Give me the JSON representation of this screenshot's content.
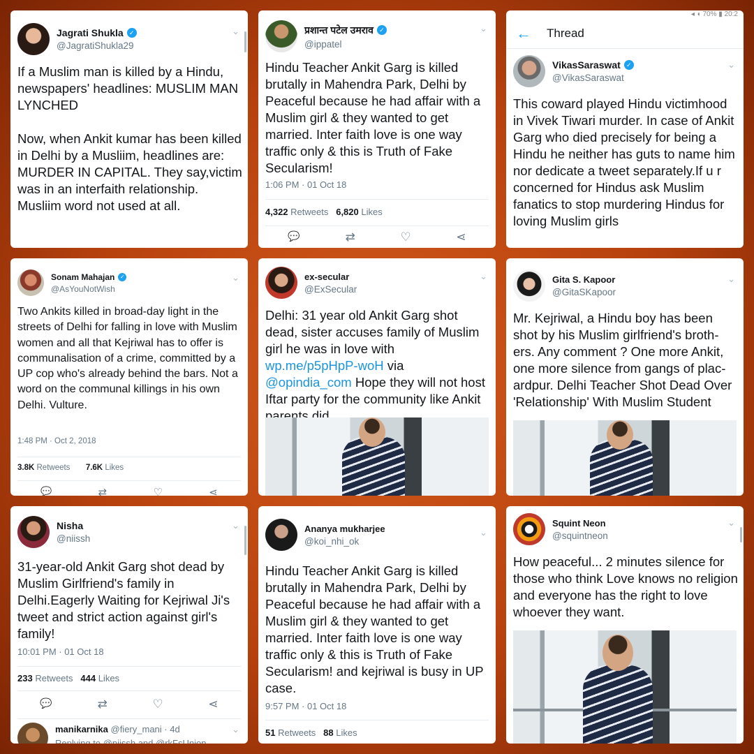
{
  "tweets": [
    {
      "name": "Jagrati Shukla",
      "handle": "@JagratiShukla29",
      "text": "If a Muslim man is killed by a Hindu, newspapers' headlines: MUSLIM MAN LYNCHED\n\nNow, when Ankit kumar has been killed in Delhi by a Musliim, headlines are: MURDER IN CAPITAL. They say,victim was in an interfaith relationship. Musliim word not used at all."
    },
    {
      "name": "प्रशान्त पटेल उमराव",
      "handle": "@ippatel",
      "text": "Hindu Teacher Ankit Garg is killed brutally in Mahendra Park, Delhi by Peaceful because he had affair with a Muslim girl & they wanted to get married. Inter faith love is one way traffic only & this is Truth of Fake Secularism!",
      "time": "1:06 PM · 01 Oct 18",
      "retweets": "4,322",
      "retweets_label": "Retweets",
      "likes": "6,820",
      "likes_label": "Likes"
    },
    {
      "status_bar": "◂ ◖ 70% ▮ 20:2",
      "back_label": "←",
      "thread_title": "Thread",
      "name": "VikasSaraswat",
      "handle": "@VikasSaraswat",
      "text": "This coward played Hindu victimhood in Vivek Tiwari murder. In case of Ankit Garg who died precisely for being a Hindu he neither has guts to name him nor dedicate a tweet separately.If u r concerned for Hindus ask Muslim fanatics to stop murdering Hindus for loving Muslim girls"
    },
    {
      "name": "Sonam Mahajan",
      "handle": "@AsYouNotWish",
      "text": "Two Ankits killed in broad-day light in the streets of Delhi for falling in love with Muslim women and all that Kejriwal has to offer is communalisation of a crime, committed by a UP cop who's already behind the bars. Not a word on the communal killings in his own Delhi. Vulture.",
      "time": "1:48 PM · Oct 2, 2018",
      "retweets": "3.8K",
      "retweets_label": "Retweets",
      "likes": "7.6K",
      "likes_label": "Likes"
    },
    {
      "name": "ex-secular",
      "handle": "@ExSecular",
      "text_a": "Delhi: 31 year old Ankit Garg shot dead, sister accuses family of Muslim girl he was in love with ",
      "link1": "wp.me/p5pHpP-woH",
      "text_b": " via ",
      "link2": "@opindia_com",
      "text_c": " Hope they will not host Iftar party for the community like Ankit parents did"
    },
    {
      "name": "Gita S. Kapoor",
      "handle": "@GitaSKapoor",
      "text": "Mr. Kejriwal, a Hindu boy has been shot by his Muslim girlfriend's broth-ers. Any comment ? One more Ankit, one more silence from gangs of plac-ardpur.  Delhi Teacher Shot Dead Over 'Relationship' With Muslim Student"
    },
    {
      "name": "Nisha",
      "handle": "@niissh",
      "text": "31-year-old Ankit Garg shot dead by Muslim Girlfriend's family in Delhi.Eagerly Waiting for Kejriwal Ji's tweet and strict action against girl's family!",
      "time": "10:01 PM · 01 Oct 18",
      "retweets": "233",
      "retweets_label": "Retweets",
      "likes": "444",
      "likes_label": "Likes",
      "reply_name": "manikarnika",
      "reply_handle": "@fiery_mani · 4d",
      "reply_to": "Replying to @niissh and @rkFsUnion"
    },
    {
      "name": "Ananya mukharjee",
      "handle": "@koi_nhi_ok",
      "text": "Hindu Teacher Ankit Garg is killed brutally in Mahendra Park, Delhi by Peaceful because he had affair with a Muslim girl & they wanted to get married. Inter faith love is one way traffic only & this is Truth of Fake Secularism! and kejriwal is busy in UP case.",
      "time": "9:57 PM · 01 Oct 18",
      "retweets": "51",
      "retweets_label": "Retweets",
      "likes": "88",
      "likes_label": "Likes"
    },
    {
      "name": "Squint Neon",
      "handle": "@squintneon",
      "text": "How peaceful... 2 minutes silence for those who think Love knows no religion and everyone has the right to love whoever they want."
    }
  ],
  "icons": {
    "reply": "💬",
    "retweet": "⇄",
    "like": "♡",
    "share": "⋖",
    "verified": "✓",
    "chevron": "⌄"
  }
}
